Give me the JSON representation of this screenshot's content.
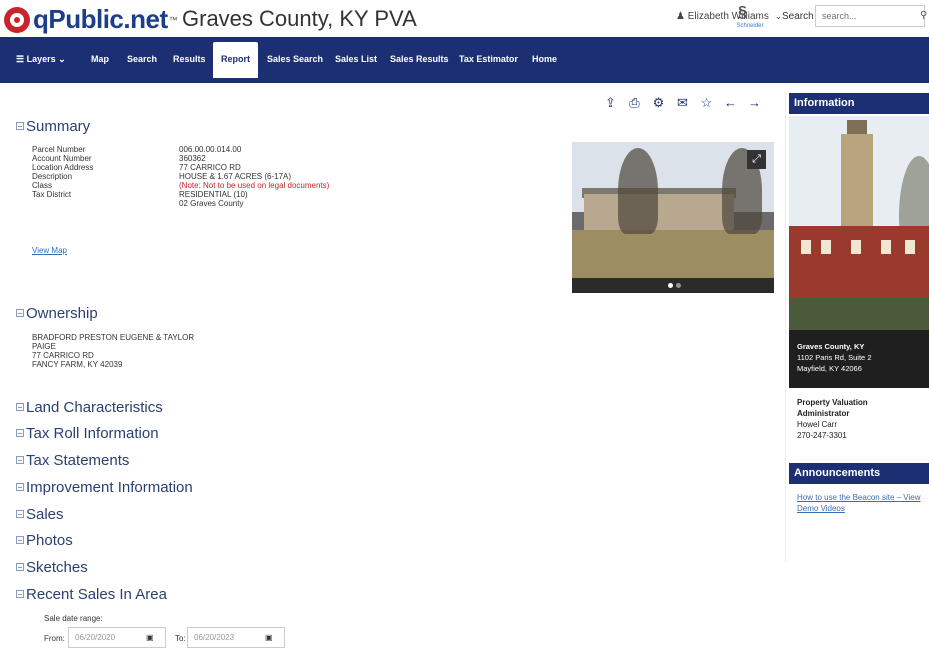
{
  "header": {
    "brand": "qPublic.net",
    "brand_tm": "™",
    "site_title": "Graves County, KY PVA",
    "user": "Elizabeth Williams",
    "schneider_label": "Schneider",
    "search_label": "Search",
    "search_placeholder": "search..."
  },
  "nav": {
    "items": [
      {
        "label": "☰ Layers ⌄"
      },
      {
        "label": "Map"
      },
      {
        "label": "Search"
      },
      {
        "label": "Results"
      },
      {
        "label": "Report"
      },
      {
        "label": "Sales Search"
      },
      {
        "label": "Sales List"
      },
      {
        "label": "Sales Results"
      },
      {
        "label": "Tax Estimator"
      },
      {
        "label": "Home"
      }
    ],
    "active": "Report"
  },
  "toolbar": [
    "share-icon",
    "print-icon",
    "gear-icon",
    "email-icon",
    "star-icon",
    "arrow-left-icon",
    "arrow-right-icon"
  ],
  "summary": {
    "title": "Summary",
    "labels": [
      "Parcel Number",
      "Account Number",
      "Location Address",
      "Description",
      "",
      "Class",
      "Tax District"
    ],
    "values": [
      "006.00.00.014.00",
      "360362",
      "77 CARRICO RD",
      "HOUSE & 1.67 ACRES (6-17A)",
      "(Note: Not to be used on legal documents)",
      "RESIDENTIAL (10)",
      "02 Graves County"
    ],
    "view_map": "View Map"
  },
  "ownership": {
    "title": "Ownership",
    "lines": [
      "BRADFORD PRESTON EUGENE & TAYLOR",
      "PAIGE",
      "77 CARRICO RD",
      "FANCY FARM, KY 42039"
    ]
  },
  "sections": [
    "Land Characteristics",
    "Tax Roll Information",
    "Tax Statements",
    "Improvement Information",
    "Sales",
    "Photos",
    "Sketches",
    "Recent Sales In Area"
  ],
  "recent_sales": {
    "range_label": "Sale date range:",
    "from_label": "From:",
    "from_value": "06/20/2020",
    "to_label": "To:",
    "to_value": "06/20/2023"
  },
  "sidebar": {
    "info_title": "Information",
    "caption": [
      "Graves County, KY",
      "1102 Paris Rd, Suite 2",
      "Mayfield, KY 42066"
    ],
    "pva": [
      "Property Valuation",
      "Administrator",
      "Howel Carr",
      "270-247-3301"
    ],
    "announce_title": "Announcements",
    "announce_link_1": "How to use the Beacon site – View",
    "announce_link_2": "Demo Videos"
  }
}
